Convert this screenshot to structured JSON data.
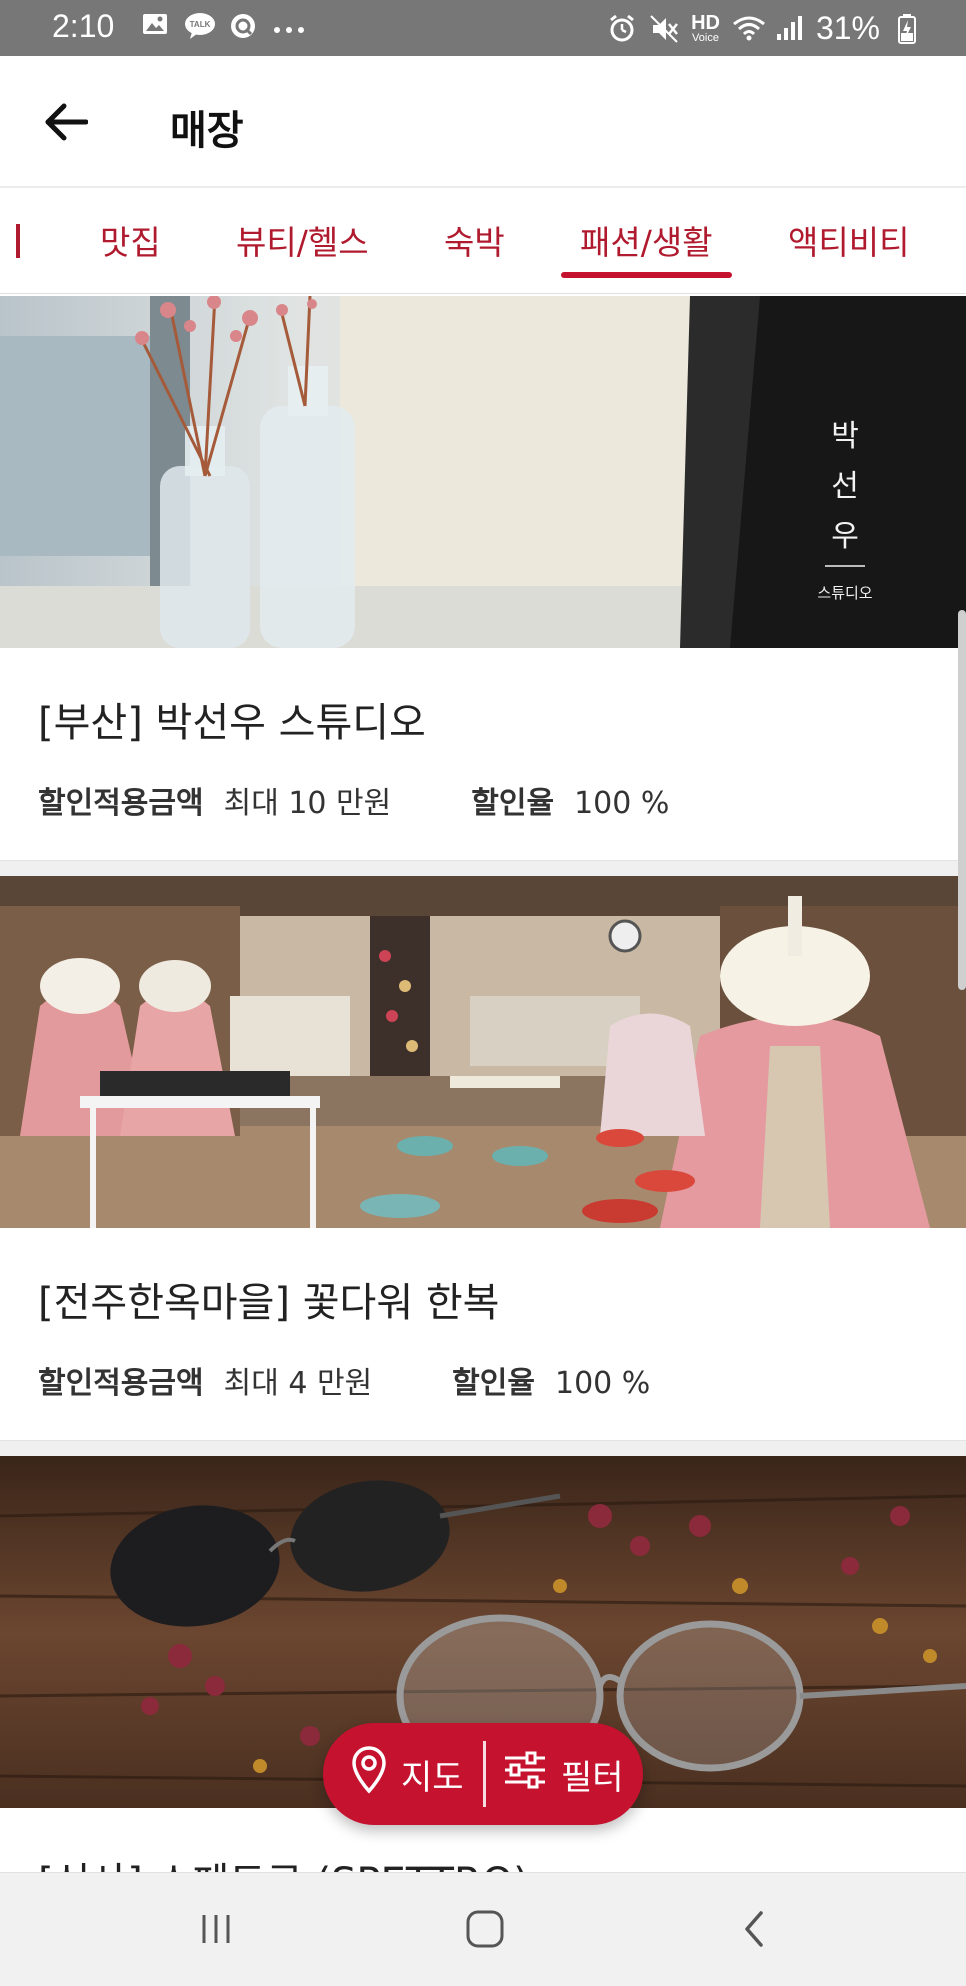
{
  "status_bar": {
    "time": "2:10",
    "battery": "31%",
    "network_label": "HD"
  },
  "header": {
    "title": "매장"
  },
  "tabs": [
    {
      "label": "맛집"
    },
    {
      "label": "뷰티/헬스"
    },
    {
      "label": "숙박"
    },
    {
      "label": "패션/생활",
      "active": true
    },
    {
      "label": "액티비티"
    }
  ],
  "stores": [
    {
      "title": "[부산] 박선우 스튜디오",
      "discount_amount_label": "할인적용금액",
      "discount_amount_value": "최대 10 만원",
      "discount_rate_label": "할인율",
      "discount_rate_value": "100 %",
      "image_text_vertical": [
        "박",
        "선",
        "우"
      ],
      "image_text_small": "스튜디오"
    },
    {
      "title": "[전주한옥마을] 꽃다워 한복",
      "discount_amount_label": "할인적용금액",
      "discount_amount_value": "최대 4 만원",
      "discount_rate_label": "할인율",
      "discount_rate_value": "100 %"
    },
    {
      "title": "[신사] 스페트로 (SPETTRO)"
    }
  ],
  "fab": {
    "map_label": "지도",
    "filter_label": "필터"
  },
  "colors": {
    "accent": "#c4122f",
    "tab_text": "#b01a2e",
    "status_bar": "#777777"
  }
}
